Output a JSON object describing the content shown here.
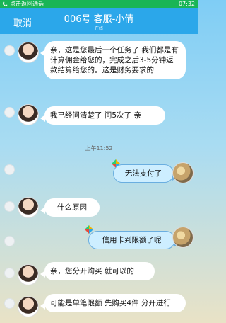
{
  "status_bar": {
    "text": "点击返回通话",
    "time": "07:32",
    "color": "#19b556"
  },
  "header": {
    "back_label": "取消",
    "title": "006号    客服-小倩",
    "subtitle": "在线",
    "color": "#2ba7ea"
  },
  "timestamp": "上午11:52",
  "messages": [
    {
      "side": "left",
      "text": "亲，这是您最后一个任务了 我们都是有计算佣金给您的，完成之后3-5分钟返款结算给您的。这是财务要求的"
    },
    {
      "side": "left",
      "text": "我已经问清楚了 问5次了 亲"
    },
    {
      "side": "right",
      "text": "无法支付了"
    },
    {
      "side": "left",
      "text": "什么原因"
    },
    {
      "side": "right",
      "text": "信用卡到限额了呢"
    },
    {
      "side": "left",
      "text": "亲，您分开购买 就可以的"
    },
    {
      "side": "left",
      "text": "可能是单笔限额 先购买4件 分开进行"
    }
  ]
}
